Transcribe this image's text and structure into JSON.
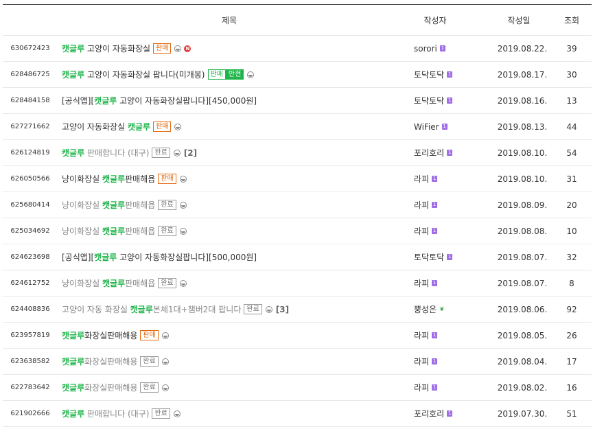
{
  "header": {
    "title": "제목",
    "author": "작성자",
    "date": "작성일",
    "views": "조회"
  },
  "labels": {
    "sale": "판매",
    "safe_a": "판매",
    "safe_b": "안전",
    "done": "완료",
    "new": "N"
  },
  "rows": [
    {
      "no": "630672423",
      "segments": [
        {
          "t": "캣글루",
          "h": true
        },
        {
          "t": " 고양이 자동화장실",
          "h": false
        }
      ],
      "badge": "sale",
      "image": true,
      "new": true,
      "comments": "",
      "dim": false,
      "author": "sorori",
      "author_icon": "level",
      "date": "2019.08.22.",
      "views": "39"
    },
    {
      "no": "628486725",
      "segments": [
        {
          "t": "캣글루",
          "h": true
        },
        {
          "t": " 고양이 자동화장실 팝니다(미개봉)",
          "h": false
        }
      ],
      "badge": "safe",
      "image": true,
      "new": false,
      "comments": "",
      "dim": false,
      "author": "토닥토닥",
      "author_icon": "level",
      "date": "2019.08.17.",
      "views": "30"
    },
    {
      "no": "628484158",
      "segments": [
        {
          "t": "[공식앱][",
          "h": false
        },
        {
          "t": "캣글루",
          "h": true
        },
        {
          "t": " 고양이 자동화장실팝니다][450,000원]",
          "h": false
        }
      ],
      "badge": "",
      "image": false,
      "new": false,
      "comments": "",
      "dim": false,
      "author": "토닥토닥",
      "author_icon": "level",
      "date": "2019.08.16.",
      "views": "13"
    },
    {
      "no": "627271662",
      "segments": [
        {
          "t": "고양이 자동화장실 ",
          "h": false
        },
        {
          "t": "캣글루",
          "h": true
        }
      ],
      "badge": "sale",
      "image": true,
      "new": false,
      "comments": "",
      "dim": false,
      "author": "WiFier",
      "author_icon": "level",
      "date": "2019.08.13.",
      "views": "44"
    },
    {
      "no": "626124819",
      "segments": [
        {
          "t": "캣글루",
          "h": true
        },
        {
          "t": " 판매합니다 (대구)",
          "h": false
        }
      ],
      "badge": "done",
      "image": true,
      "new": false,
      "comments": "[2]",
      "dim": true,
      "author": "포리호리",
      "author_icon": "level",
      "date": "2019.08.10.",
      "views": "54"
    },
    {
      "no": "626050566",
      "segments": [
        {
          "t": "냥이화장실 ",
          "h": false
        },
        {
          "t": "캣글루",
          "h": true
        },
        {
          "t": "판매해욥",
          "h": false
        }
      ],
      "badge": "sale",
      "image": true,
      "new": false,
      "comments": "",
      "dim": false,
      "author": "라피",
      "author_icon": "level",
      "date": "2019.08.10.",
      "views": "31"
    },
    {
      "no": "625680414",
      "segments": [
        {
          "t": "냥이화장실 ",
          "h": false
        },
        {
          "t": "캣글루",
          "h": true
        },
        {
          "t": "판매해욥",
          "h": false
        }
      ],
      "badge": "done",
      "image": true,
      "new": false,
      "comments": "",
      "dim": true,
      "author": "라피",
      "author_icon": "level",
      "date": "2019.08.09.",
      "views": "20"
    },
    {
      "no": "625034692",
      "segments": [
        {
          "t": "냥이화장실 ",
          "h": false
        },
        {
          "t": "캣글루",
          "h": true
        },
        {
          "t": "판매해욥",
          "h": false
        }
      ],
      "badge": "done",
      "image": true,
      "new": false,
      "comments": "",
      "dim": true,
      "author": "라피",
      "author_icon": "level",
      "date": "2019.08.08.",
      "views": "10"
    },
    {
      "no": "624623698",
      "segments": [
        {
          "t": "[공식앱][",
          "h": false
        },
        {
          "t": "캣글루",
          "h": true
        },
        {
          "t": " 고양이 자동화장실팝니다][500,000원]",
          "h": false
        }
      ],
      "badge": "",
      "image": false,
      "new": false,
      "comments": "",
      "dim": false,
      "author": "토닥토닥",
      "author_icon": "level",
      "date": "2019.08.07.",
      "views": "32"
    },
    {
      "no": "624612752",
      "segments": [
        {
          "t": "냥이화장실 ",
          "h": false
        },
        {
          "t": "캣글루",
          "h": true
        },
        {
          "t": "판매해욥",
          "h": false
        }
      ],
      "badge": "done",
      "image": true,
      "new": false,
      "comments": "",
      "dim": true,
      "author": "라피",
      "author_icon": "level",
      "date": "2019.08.07.",
      "views": "8"
    },
    {
      "no": "624408836",
      "segments": [
        {
          "t": "고양이 자동 화장실 ",
          "h": false
        },
        {
          "t": "캣글루",
          "h": true
        },
        {
          "t": "본체1대+챔버2대 팝니다",
          "h": false
        }
      ],
      "badge": "done",
      "image": true,
      "new": false,
      "comments": "[3]",
      "dim": true,
      "author": "뿡성은",
      "author_icon": "sprout",
      "date": "2019.08.06.",
      "views": "92"
    },
    {
      "no": "623957819",
      "segments": [
        {
          "t": "캣글루",
          "h": true
        },
        {
          "t": "화장실판매해용",
          "h": false
        }
      ],
      "badge": "sale",
      "image": true,
      "new": false,
      "comments": "",
      "dim": false,
      "author": "라피",
      "author_icon": "level",
      "date": "2019.08.05.",
      "views": "26"
    },
    {
      "no": "623638582",
      "segments": [
        {
          "t": "캣글루",
          "h": true
        },
        {
          "t": "화장실판매해용",
          "h": false
        }
      ],
      "badge": "done",
      "image": true,
      "new": false,
      "comments": "",
      "dim": true,
      "author": "라피",
      "author_icon": "level",
      "date": "2019.08.04.",
      "views": "17"
    },
    {
      "no": "622783642",
      "segments": [
        {
          "t": "캣글루",
          "h": true
        },
        {
          "t": "화장실판매해용",
          "h": false
        }
      ],
      "badge": "done",
      "image": true,
      "new": false,
      "comments": "",
      "dim": true,
      "author": "라피",
      "author_icon": "level",
      "date": "2019.08.02.",
      "views": "16"
    },
    {
      "no": "621902666",
      "segments": [
        {
          "t": "캣글루",
          "h": true
        },
        {
          "t": " 판매합니다 (대구)",
          "h": false
        }
      ],
      "badge": "done",
      "image": true,
      "new": false,
      "comments": "",
      "dim": true,
      "author": "포리호리",
      "author_icon": "level",
      "date": "2019.07.30.",
      "views": "51"
    }
  ]
}
